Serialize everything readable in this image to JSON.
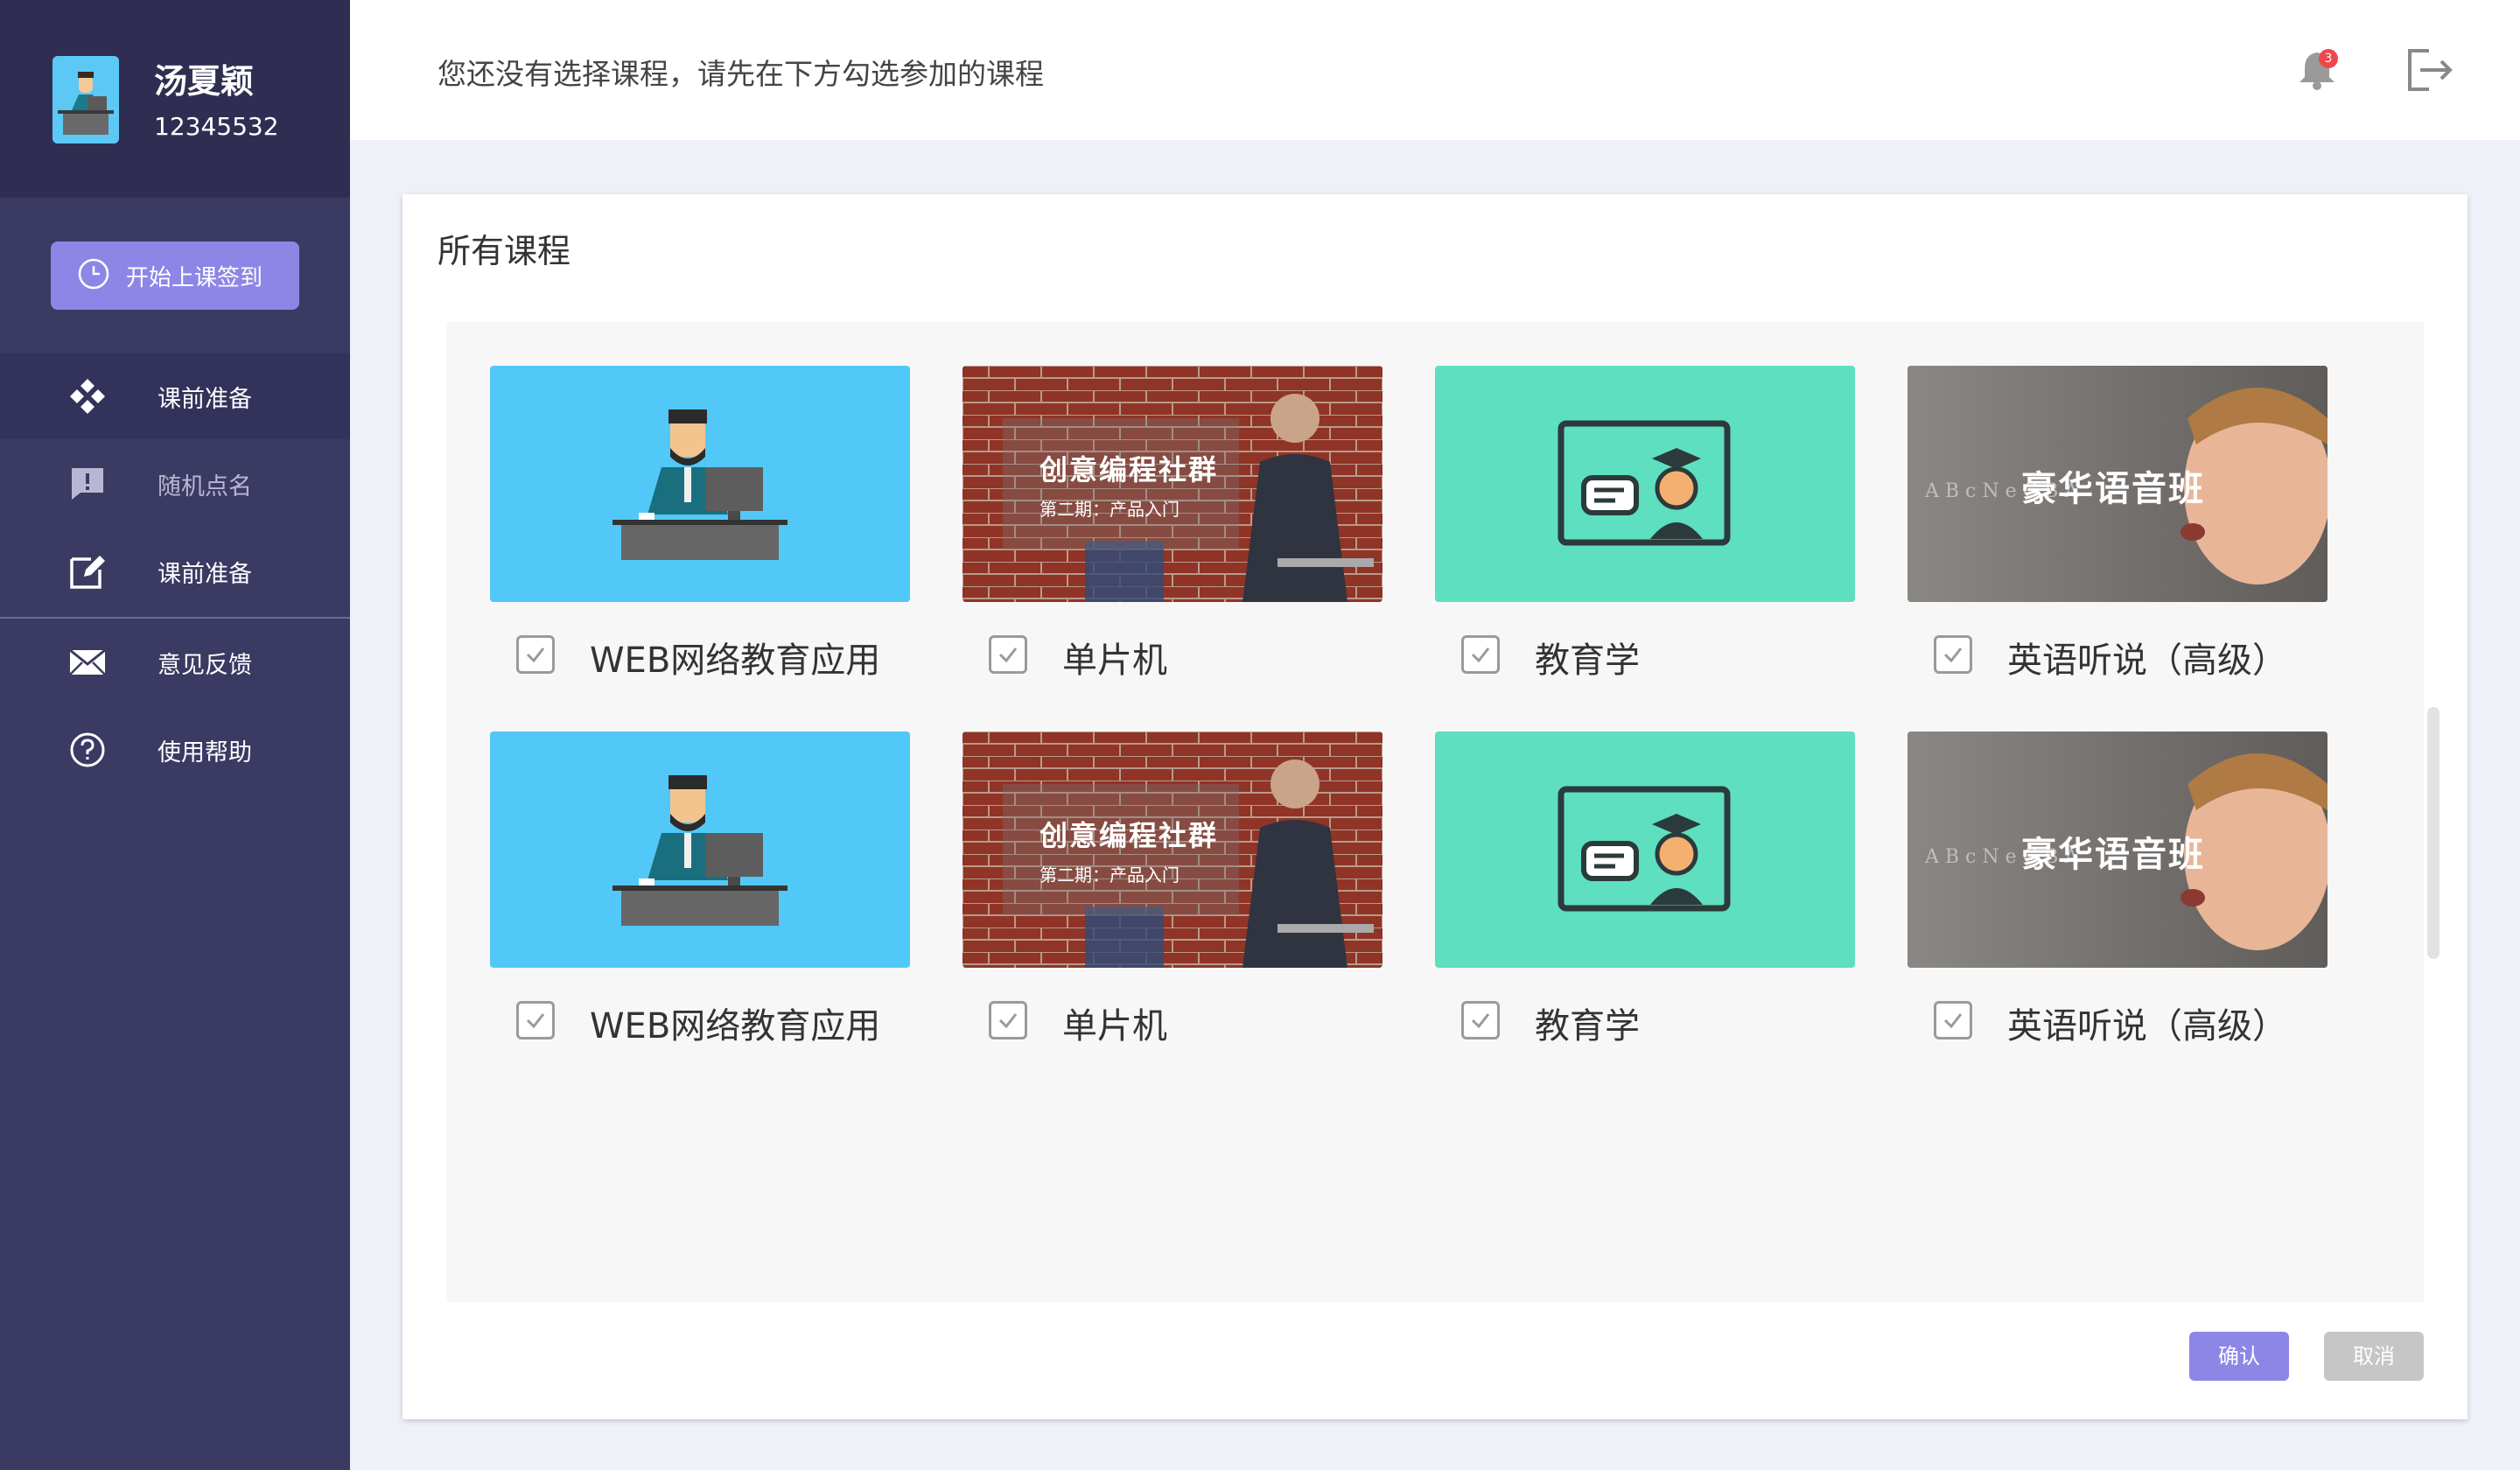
{
  "user": {
    "name": "汤夏颖",
    "id": "12345532"
  },
  "sidebar": {
    "checkin_label": "开始上课签到",
    "items": [
      {
        "label": "课前准备",
        "icon": "diamond-grid-icon"
      },
      {
        "label": "随机点名",
        "icon": "alert-message-icon"
      },
      {
        "label": "课前准备",
        "icon": "edit-icon"
      },
      {
        "label": "意见反馈",
        "icon": "mail-icon"
      },
      {
        "label": "使用帮助",
        "icon": "help-icon"
      }
    ]
  },
  "header": {
    "notice": "您还没有选择课程，请先在下方勾选参加的课程",
    "badge_count": "3"
  },
  "card": {
    "title": "所有课程"
  },
  "courses": [
    {
      "name": "WEB网络教育应用",
      "thumb": "teacher-desk"
    },
    {
      "name": "单片机",
      "thumb": "coding-brick",
      "overlay_title": "创意编程社群",
      "overlay_sub": "第二期：产品入门"
    },
    {
      "name": "教育学",
      "thumb": "graduate-screen"
    },
    {
      "name": "英语听说（高级）",
      "thumb": "child-speaking",
      "overlay_title": "豪华语音班"
    },
    {
      "name": "WEB网络教育应用",
      "thumb": "teacher-desk"
    },
    {
      "name": "单片机",
      "thumb": "coding-brick",
      "overlay_title": "创意编程社群",
      "overlay_sub": "第二期：产品入门"
    },
    {
      "name": "教育学",
      "thumb": "graduate-screen"
    },
    {
      "name": "英语听说（高级）",
      "thumb": "child-speaking",
      "overlay_title": "豪华语音班"
    }
  ],
  "buttons": {
    "confirm": "确认",
    "cancel": "取消"
  },
  "colors": {
    "sidebar": "#3b3a63",
    "accent": "#8e86e6",
    "blue_thumb": "#52c8f8",
    "green_thumb": "#5ddfc0"
  }
}
